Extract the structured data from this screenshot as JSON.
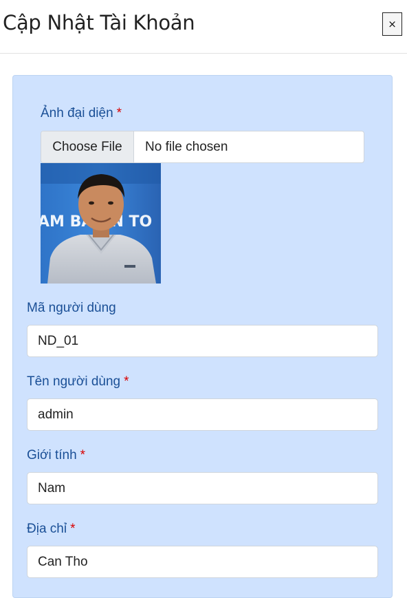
{
  "modal": {
    "title": "Cập Nhật Tài Khoản",
    "close_label": "×"
  },
  "form": {
    "avatar": {
      "label": "Ảnh đại diện",
      "required_mark": "*",
      "choose_button": "Choose File",
      "file_status": "No file chosen",
      "banner_text": "AM BAN N TO"
    },
    "user_id": {
      "label": "Mã người dùng",
      "value": "ND_01"
    },
    "user_name": {
      "label": "Tên người dùng",
      "required_mark": "*",
      "value": "admin"
    },
    "gender": {
      "label": "Giới tính",
      "required_mark": "*",
      "value": "Nam"
    },
    "address": {
      "label": "Địa chỉ",
      "required_mark": "*",
      "value": "Can Tho"
    }
  },
  "colors": {
    "card_background": "#cfe2fe",
    "label_text": "#1a4f96",
    "required_mark": "#d90000"
  }
}
